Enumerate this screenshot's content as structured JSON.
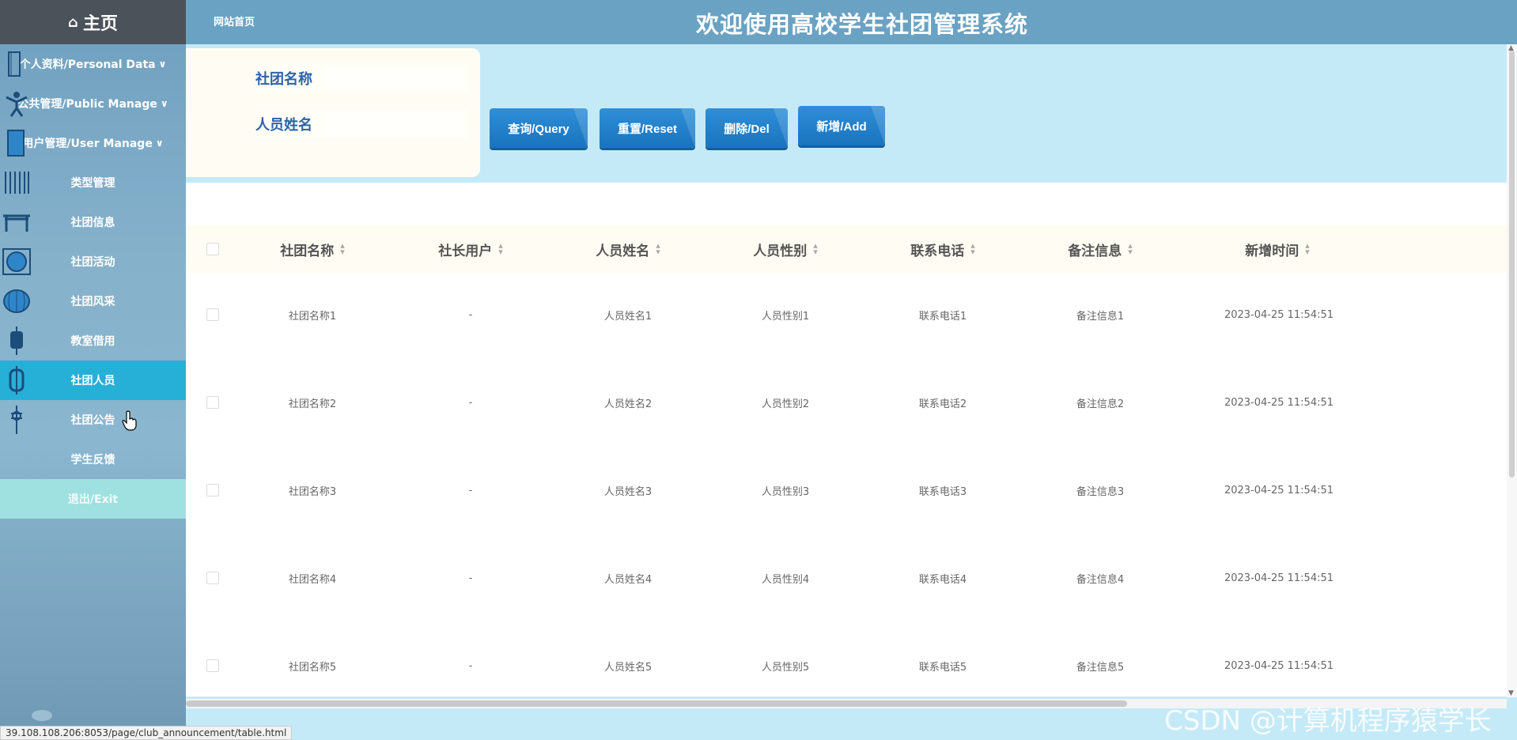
{
  "sidebar": {
    "home_label": "主页",
    "items": [
      {
        "label": "个人资料/Personal Data",
        "chevron": "v"
      },
      {
        "label": "公共管理/Public Manage",
        "chevron": "v"
      },
      {
        "label": "用户管理/User Manage",
        "chevron": "v"
      },
      {
        "label": "类型管理"
      },
      {
        "label": "社团信息"
      },
      {
        "label": "社团活动"
      },
      {
        "label": "社团风采"
      },
      {
        "label": "教室借用"
      },
      {
        "label": "社团人员"
      },
      {
        "label": "社团公告"
      },
      {
        "label": "学生反馈"
      },
      {
        "label": "退出/Exit"
      }
    ]
  },
  "header": {
    "home_link": "网站首页",
    "title": "欢迎使用高校学生社团管理系统"
  },
  "search": {
    "field1_label": "社团名称",
    "field2_label": "人员姓名"
  },
  "buttons": {
    "query": "查询/Query",
    "reset": "重置/Reset",
    "delete": "删除/Del",
    "add": "新增/Add"
  },
  "table": {
    "columns": [
      "社团名称",
      "社长用户",
      "人员姓名",
      "人员性别",
      "联系电话",
      "备注信息",
      "新增时间"
    ],
    "rows": [
      [
        "社团名称1",
        "-",
        "人员姓名1",
        "人员性别1",
        "联系电话1",
        "备注信息1",
        "2023-04-25 11:54:51"
      ],
      [
        "社团名称2",
        "-",
        "人员姓名2",
        "人员性别2",
        "联系电话2",
        "备注信息2",
        "2023-04-25 11:54:51"
      ],
      [
        "社团名称3",
        "-",
        "人员姓名3",
        "人员性别3",
        "联系电话3",
        "备注信息3",
        "2023-04-25 11:54:51"
      ],
      [
        "社团名称4",
        "-",
        "人员姓名4",
        "人员性别4",
        "联系电话4",
        "备注信息4",
        "2023-04-25 11:54:51"
      ],
      [
        "社团名称5",
        "-",
        "人员姓名5",
        "人员性别5",
        "联系电话5",
        "备注信息5",
        "2023-04-25 11:54:51"
      ]
    ]
  },
  "status_url": "39.108.108.206:8053/page/club_announcement/table.html",
  "watermark": "CSDN @计算机程序猿学长",
  "colors": {
    "header": "#6aa2c3",
    "active_item": "#27b0d7",
    "button": "#1f7cc6",
    "label": "#2d63a8"
  }
}
